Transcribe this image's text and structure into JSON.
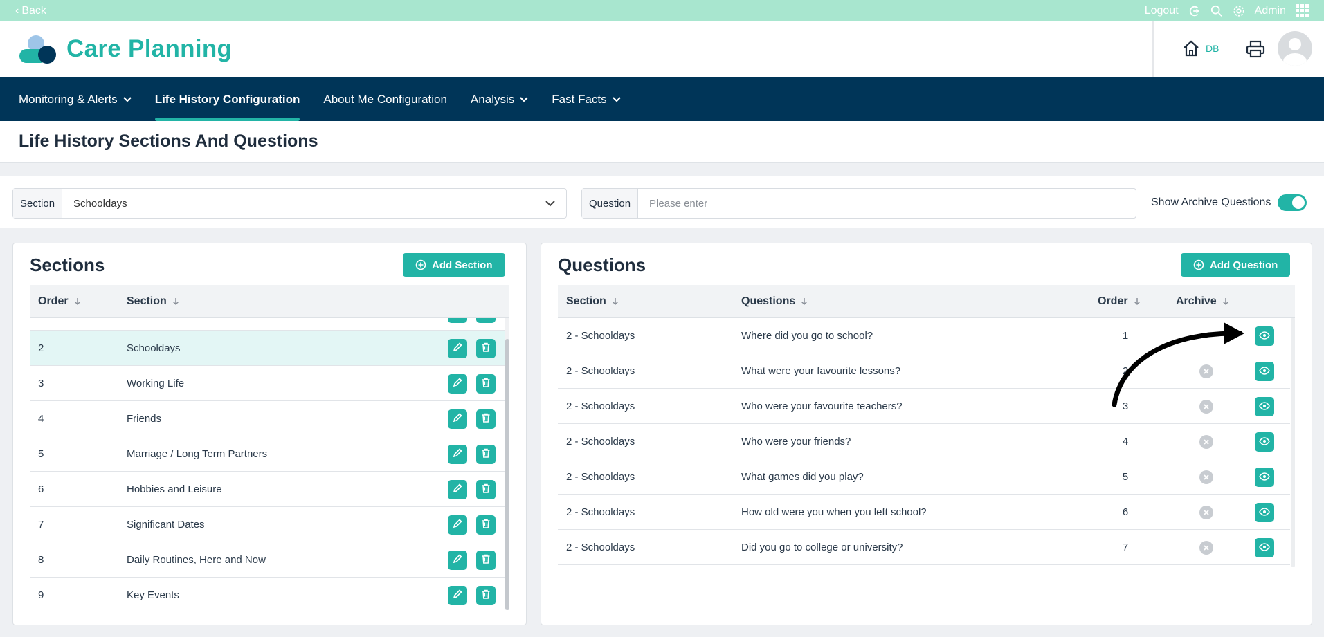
{
  "topbar": {
    "back_label": "Back",
    "logout_label": "Logout",
    "admin_label": "Admin"
  },
  "header": {
    "brand": "Care Planning",
    "home_badge": "DB"
  },
  "nav": {
    "items": [
      {
        "label": "Monitoring & Alerts",
        "dropdown": true
      },
      {
        "label": "Life History Configuration",
        "active": true
      },
      {
        "label": "About Me Configuration"
      },
      {
        "label": "Analysis",
        "dropdown": true
      },
      {
        "label": "Fast Facts",
        "dropdown": true
      }
    ]
  },
  "page": {
    "title": "Life History Sections And Questions"
  },
  "filters": {
    "section_label": "Section",
    "section_value": "Schooldays",
    "question_label": "Question",
    "question_placeholder": "Please enter",
    "show_archive_label": "Show Archive Questions",
    "show_archive_on": true
  },
  "sections_panel": {
    "title": "Sections",
    "add_label": "Add Section",
    "columns": {
      "order": "Order",
      "section": "Section"
    },
    "rows": [
      {
        "order": "2",
        "section": "Schooldays",
        "selected": true
      },
      {
        "order": "3",
        "section": "Working Life"
      },
      {
        "order": "4",
        "section": "Friends"
      },
      {
        "order": "5",
        "section": "Marriage / Long Term Partners"
      },
      {
        "order": "6",
        "section": "Hobbies and Leisure"
      },
      {
        "order": "7",
        "section": "Significant Dates"
      },
      {
        "order": "8",
        "section": "Daily Routines, Here and Now"
      },
      {
        "order": "9",
        "section": "Key Events"
      }
    ]
  },
  "questions_panel": {
    "title": "Questions",
    "add_label": "Add Question",
    "columns": {
      "section": "Section",
      "questions": "Questions",
      "order": "Order",
      "archive": "Archive"
    },
    "rows": [
      {
        "section": "2 - Schooldays",
        "question": "Where did you go to school?",
        "order": "1"
      },
      {
        "section": "2 - Schooldays",
        "question": "What were your favourite lessons?",
        "order": "2"
      },
      {
        "section": "2 - Schooldays",
        "question": "Who were your favourite teachers?",
        "order": "3"
      },
      {
        "section": "2 - Schooldays",
        "question": "Who were your friends?",
        "order": "4"
      },
      {
        "section": "2 - Schooldays",
        "question": "What games did you play?",
        "order": "5"
      },
      {
        "section": "2 - Schooldays",
        "question": "How old were you when you left school?",
        "order": "6"
      },
      {
        "section": "2 - Schooldays",
        "question": "Did you go to college or university?",
        "order": "7"
      }
    ]
  },
  "colors": {
    "accent": "#22b4a6",
    "nav": "#003558",
    "topstrip": "#a8e6cf"
  }
}
